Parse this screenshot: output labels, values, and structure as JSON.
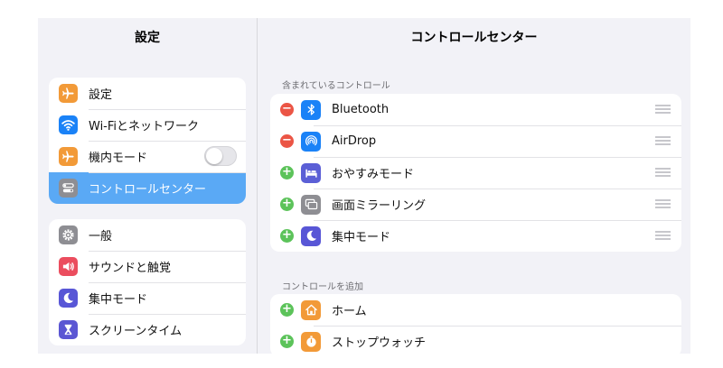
{
  "sidebar": {
    "title": "設定",
    "group1": [
      {
        "label": "設定",
        "icon": "airplane-icon",
        "color": "#f29a38"
      },
      {
        "label": "Wi-Fiとネットワーク",
        "icon": "wifi-icon",
        "color": "#1a82f7"
      },
      {
        "label": "機内モード",
        "icon": "airplane-icon",
        "color": "#f29a38",
        "toggle": false
      },
      {
        "label": "コントロールセンター",
        "icon": "toggles-icon",
        "color": "#8e8e93",
        "selected": true
      }
    ],
    "group2": [
      {
        "label": "一般",
        "icon": "gear-icon",
        "color": "#8e8e93"
      },
      {
        "label": "サウンドと触覚",
        "icon": "speaker-icon",
        "color": "#eb4d5e"
      },
      {
        "label": "集中モード",
        "icon": "moon-icon",
        "color": "#5856d6"
      },
      {
        "label": "スクリーンタイム",
        "icon": "hourglass-icon",
        "color": "#5b56d3"
      }
    ]
  },
  "main": {
    "title": "コントロールセンター",
    "included_label": "含まれているコントロール",
    "included": [
      {
        "label": "Bluetooth",
        "icon": "bluetooth-icon",
        "color": "#1a82f7",
        "action": "remove"
      },
      {
        "label": "AirDrop",
        "icon": "airdrop-icon",
        "color": "#1a82f7",
        "action": "remove"
      },
      {
        "label": "おやすみモード",
        "icon": "bed-icon",
        "color": "#5b5fd6",
        "action": "add"
      },
      {
        "label": "画面ミラーリング",
        "icon": "screen-mirroring-icon",
        "color": "#8e8e93",
        "action": "add"
      },
      {
        "label": "集中モード",
        "icon": "moon-icon",
        "color": "#5856d6",
        "action": "add"
      }
    ],
    "more_label": "コントロールを追加",
    "more": [
      {
        "label": "ホーム",
        "icon": "home-icon",
        "color": "#f29a38",
        "action": "add"
      },
      {
        "label": "ストップウォッチ",
        "icon": "stopwatch-icon",
        "color": "#f29a38",
        "action": "add"
      }
    ]
  },
  "colors": {
    "selected_row": "#5aa9f5",
    "remove_button": "#eb5545",
    "add_button": "#5cc35a"
  }
}
